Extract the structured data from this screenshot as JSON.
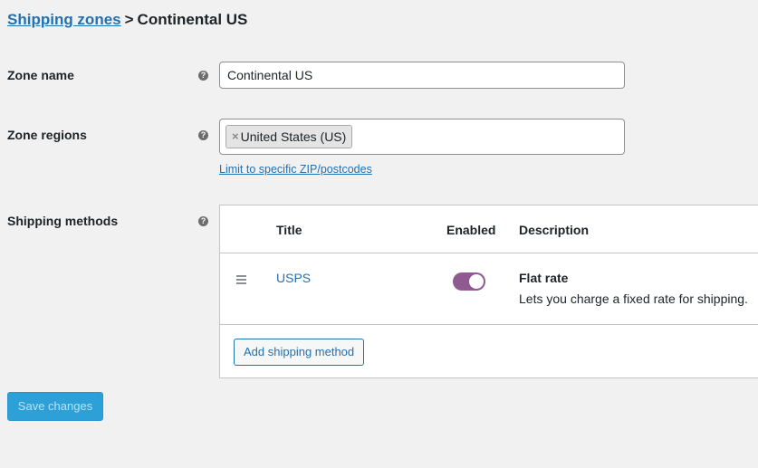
{
  "breadcrumb": {
    "parent_link": "Shipping zones",
    "separator": ">",
    "current": "Continental US"
  },
  "zone_name": {
    "label": "Zone name",
    "help_icon": "help-icon",
    "value": "Continental US"
  },
  "zone_regions": {
    "label": "Zone regions",
    "help_icon": "help-icon",
    "tokens": [
      {
        "remove_glyph": "×",
        "label": "United States (US)"
      }
    ],
    "limit_link": "Limit to specific ZIP/postcodes"
  },
  "shipping_methods": {
    "label": "Shipping methods",
    "help_icon": "help-icon",
    "columns": {
      "title": "Title",
      "enabled": "Enabled",
      "description": "Description"
    },
    "rows": [
      {
        "title": "USPS",
        "enabled": true,
        "description_title": "Flat rate",
        "description_text": "Lets you charge a fixed rate for shipping."
      }
    ],
    "add_button": "Add shipping method"
  },
  "save_button": "Save changes",
  "colors": {
    "link": "#2271b1",
    "toggle_on": "#8e5a8f",
    "save_button_bg": "#2ea0d8"
  }
}
